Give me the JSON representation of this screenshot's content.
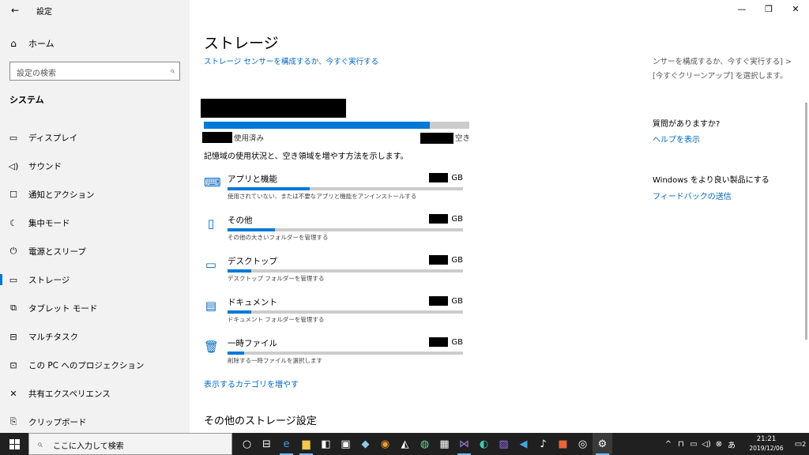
{
  "titlebar": {
    "back_icon": "back-arrow-icon",
    "app_title": "設定"
  },
  "sidebar": {
    "home_label": "ホーム",
    "search_placeholder": "設定の検索",
    "section": "システム",
    "items": [
      {
        "label": "ディスプレイ",
        "icon": "display-icon"
      },
      {
        "label": "サウンド",
        "icon": "speaker-icon"
      },
      {
        "label": "通知とアクション",
        "icon": "notification-icon"
      },
      {
        "label": "集中モード",
        "icon": "moon-icon"
      },
      {
        "label": "電源とスリープ",
        "icon": "power-icon"
      },
      {
        "label": "ストレージ",
        "icon": "storage-icon",
        "active": true
      },
      {
        "label": "タブレット モード",
        "icon": "tablet-icon"
      },
      {
        "label": "マルチタスク",
        "icon": "multitask-icon"
      },
      {
        "label": "この PC へのプロジェクション",
        "icon": "projection-icon"
      },
      {
        "label": "共有エクスペリエンス",
        "icon": "share-icon"
      },
      {
        "label": "クリップボード",
        "icon": "clipboard-icon"
      }
    ]
  },
  "main": {
    "title": "ストレージ",
    "sense_link": "ストレージ センサーを構成するか、今すぐ実行する",
    "used_label": "使用済み",
    "free_label": "空き",
    "used_fraction": 0.85,
    "description": "記憶域の使用状況と、空き領域を増やす方法を示します。",
    "categories": [
      {
        "name": "アプリと機能",
        "unit": "GB",
        "sub": "使用されていない、または不要なアプリと機能をアンインストールする",
        "fraction": 0.35,
        "icon": "apps-icon"
      },
      {
        "name": "その他",
        "unit": "GB",
        "sub": "その他の大きいフォルダーを管理する",
        "fraction": 0.2,
        "icon": "other-file-icon"
      },
      {
        "name": "デスクトップ",
        "unit": "GB",
        "sub": "デスクトップ フォルダーを管理する",
        "fraction": 0.1,
        "icon": "desktop-icon"
      },
      {
        "name": "ドキュメント",
        "unit": "GB",
        "sub": "ドキュメント フォルダーを管理する",
        "fraction": 0.1,
        "icon": "documents-icon"
      },
      {
        "name": "一時ファイル",
        "unit": "GB",
        "sub": "削除する一時ファイルを選択します",
        "fraction": 0.07,
        "icon": "trash-icon"
      }
    ],
    "more_link": "表示するカテゴリを増やす",
    "other_header": "その他のストレージ設定"
  },
  "right": {
    "line1": "ンサーを構成するか、今すぐ実行する] >",
    "line2": "[今すぐクリーンアップ] を選択します。",
    "question": "質問がありますか?",
    "help_link": "ヘルプを表示",
    "improve": "Windows をより良い製品にする",
    "feedback_link": "フィードバックの送信"
  },
  "taskbar": {
    "search_placeholder": "ここに入力して検索",
    "time": "21:21",
    "date": "2019/12/06",
    "notif_count": "2"
  }
}
